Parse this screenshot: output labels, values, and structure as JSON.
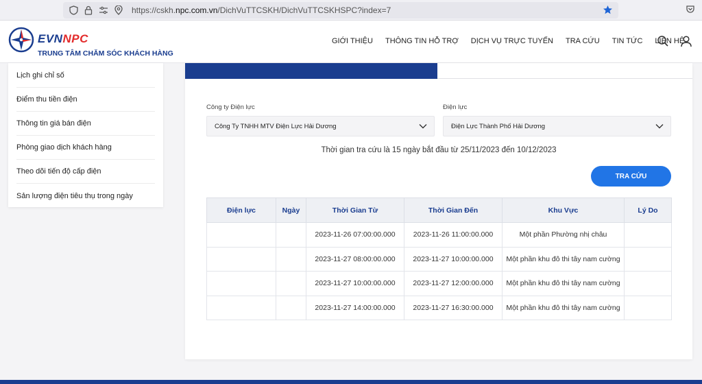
{
  "browser": {
    "url_prefix": "https://cskh.",
    "url_domain": "npc.com.vn",
    "url_path": "/DichVuTTCSKH/DichVuTTCSKHSPC?index=7"
  },
  "header": {
    "logo_evn": "EVN",
    "logo_npc": "NPC",
    "logo_subtitle": "TRUNG TÂM CHĂM SÓC KHÁCH HÀNG",
    "nav": [
      "GIỚI THIỆU",
      "THÔNG TIN HỖ TRỢ",
      "DỊCH VỤ TRỰC TUYẾN",
      "TRA CỨU",
      "TIN TỨC",
      "LIÊN HỆ"
    ]
  },
  "sidebar": {
    "items": [
      "Lịch ghi chỉ số",
      "Điểm thu tiền điện",
      "Thông tin giá bán điện",
      "Phòng giao dịch khách hàng",
      "Theo dõi tiến độ cấp điện",
      "Sản lượng điện tiêu thụ trong ngày"
    ]
  },
  "form": {
    "company_label": "Công ty Điện lực",
    "company_value": "Công Ty TNHH MTV Điện Lực Hải Dương",
    "branch_label": "Điện lực",
    "branch_value": "Điện Lực Thành Phố Hải Dương",
    "range_note": "Thời gian tra cứu là 15 ngày bắt đầu từ 25/11/2023 đến 10/12/2023",
    "search_label": "TRA CỨU"
  },
  "table": {
    "headers": [
      "Điện lực",
      "Ngày",
      "Thời Gian Từ",
      "Thời Gian Đến",
      "Khu Vực",
      "Lý Do"
    ],
    "rows": [
      [
        "",
        "",
        "2023-11-26 07:00:00.000",
        "2023-11-26 11:00:00.000",
        "Một phần Phường nhị châu",
        ""
      ],
      [
        "",
        "",
        "2023-11-27 08:00:00.000",
        "2023-11-27 10:00:00.000",
        "Một phần khu đô thi tây nam cường",
        ""
      ],
      [
        "",
        "",
        "2023-11-27 10:00:00.000",
        "2023-11-27 12:00:00.000",
        "Một phần khu đô thi tây nam cường",
        ""
      ],
      [
        "",
        "",
        "2023-11-27 14:00:00.000",
        "2023-11-27 16:30:00.000",
        "Một phần khu đô thi tây nam cường",
        ""
      ]
    ]
  },
  "colors": {
    "brand_blue": "#1a3d8f",
    "brand_red": "#e32b2b",
    "button_blue": "#2175e6"
  }
}
